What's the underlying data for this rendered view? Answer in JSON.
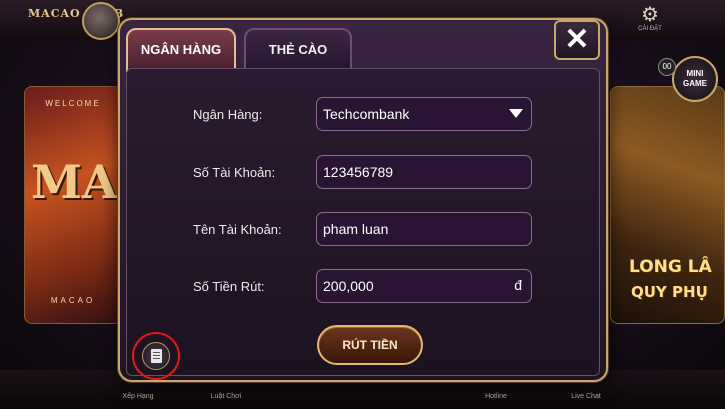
{
  "top": {
    "logo": "MACAO CLUB",
    "settings_label": "CÀI ĐẶT"
  },
  "background": {
    "left_card": {
      "welcome": "WELCOME",
      "title": "MAC",
      "footer": "MACAO"
    },
    "right_card": {
      "line1": "LONG LÂ",
      "line2": "QUY PHỤ"
    },
    "minigame": "MINI GAME",
    "badge": "00",
    "bottom_nav": [
      "Xếp Hạng",
      "Luật Chơi",
      "Hotline",
      "Live Chat"
    ]
  },
  "dialog": {
    "tabs": [
      {
        "label": "NGÂN HÀNG",
        "active": true
      },
      {
        "label": "THẺ CÀO",
        "active": false
      }
    ],
    "close_label": "✕",
    "form": {
      "bank": {
        "label": "Ngân Hàng:",
        "value": "Techcombank"
      },
      "account_number": {
        "label": "Số Tài Khoản:",
        "value": "123456789"
      },
      "account_name": {
        "label": "Tên Tài Khoản:",
        "value": "pham luan"
      },
      "amount": {
        "label": "Số Tiền Rút:",
        "value": "200,000",
        "currency": "đ"
      }
    },
    "withdraw_button": "RÚT TIỀN",
    "history_icon": "history-icon"
  },
  "colors": {
    "gold_border": "#c9a66a",
    "highlight_ring": "#e11919"
  }
}
